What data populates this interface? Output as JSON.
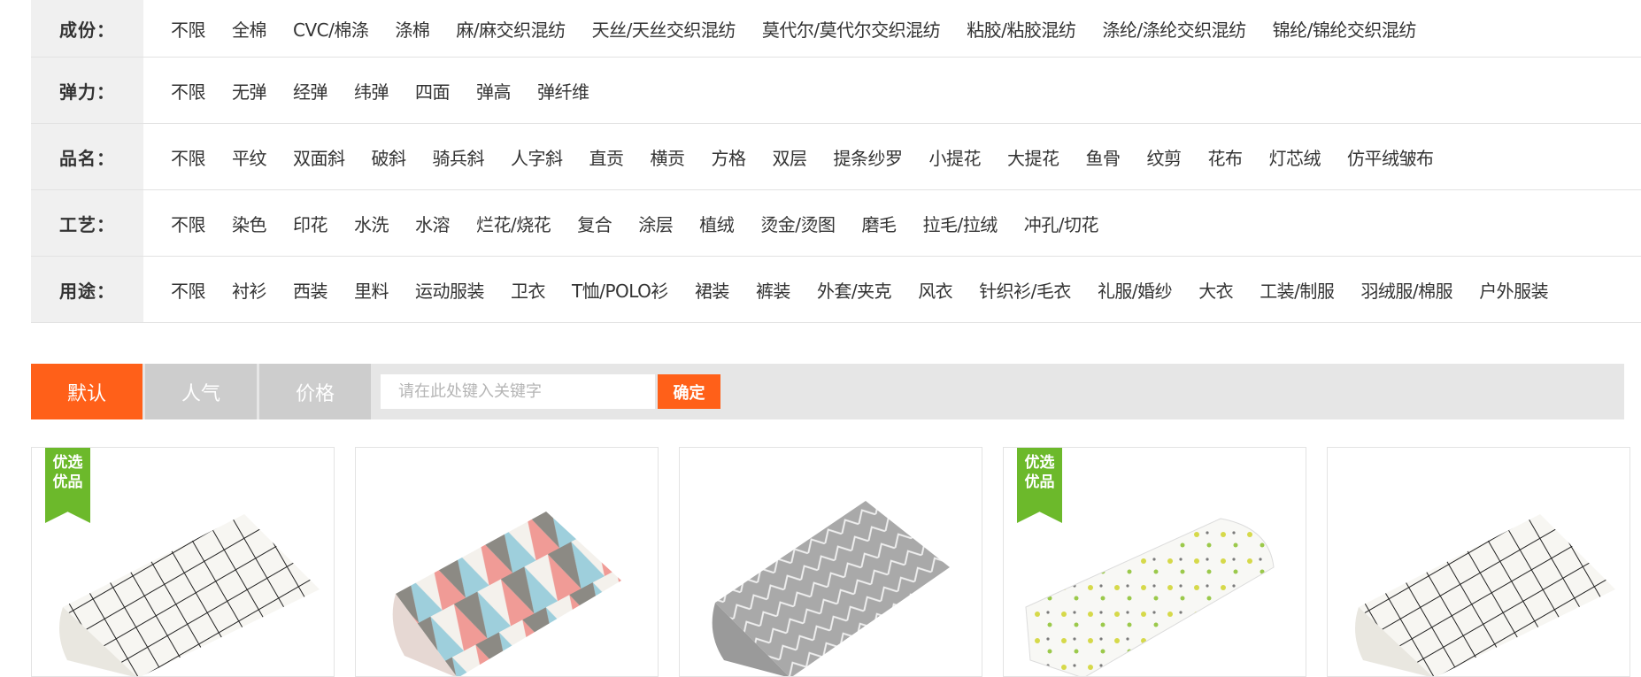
{
  "filters": [
    {
      "label": "成份：",
      "options": [
        "不限",
        "全棉",
        "CVC/棉涤",
        "涤棉",
        "麻/麻交织混纺",
        "天丝/天丝交织混纺",
        "莫代尔/莫代尔交织混纺",
        "粘胶/粘胶混纺",
        "涤纶/涤纶交织混纺",
        "锦纶/锦纶交织混纺"
      ]
    },
    {
      "label": "弹力：",
      "options": [
        "不限",
        "无弹",
        "经弹",
        "纬弹",
        "四面",
        "弹高",
        "弹纤维"
      ]
    },
    {
      "label": "品名：",
      "options": [
        "不限",
        "平纹",
        "双面斜",
        "破斜",
        "骑兵斜",
        "人字斜",
        "直贡",
        "横贡",
        "方格",
        "双层",
        "提条纱罗",
        "小提花",
        "大提花",
        "鱼骨",
        "纹剪",
        "花布",
        "灯芯绒",
        "仿平绒皱布"
      ]
    },
    {
      "label": "工艺：",
      "options": [
        "不限",
        "染色",
        "印花",
        "水洗",
        "水溶",
        "烂花/烧花",
        "复合",
        "涂层",
        "植绒",
        "烫金/烫图",
        "磨毛",
        "拉毛/拉绒",
        "冲孔/切花"
      ]
    },
    {
      "label": "用途：",
      "options": [
        "不限",
        "衬衫",
        "西装",
        "里料",
        "运动服装",
        "卫衣",
        "T恤/POLO衫",
        "裙装",
        "裤装",
        "外套/夹克",
        "风衣",
        "针织衫/毛衣",
        "礼服/婚纱",
        "大衣",
        "工装/制服",
        "羽绒服/棉服",
        "户外服装"
      ]
    }
  ],
  "sort": {
    "tabs": [
      "默认",
      "人气",
      "价格"
    ],
    "search_placeholder": "请在此处键入关键字",
    "confirm_label": "确定"
  },
  "products": [
    {
      "badge": [
        "优选",
        "优品"
      ],
      "pattern": "grid-check"
    },
    {
      "badge": null,
      "pattern": "triangle-print"
    },
    {
      "badge": null,
      "pattern": "herringbone-gray"
    },
    {
      "badge": [
        "优选",
        "优品"
      ],
      "pattern": "floral-roll"
    },
    {
      "badge": null,
      "pattern": "grid-check"
    }
  ],
  "colors": {
    "accent": "#ff6019",
    "badge": "#6cb92b",
    "tab_inactive": "#cdcdcd"
  }
}
